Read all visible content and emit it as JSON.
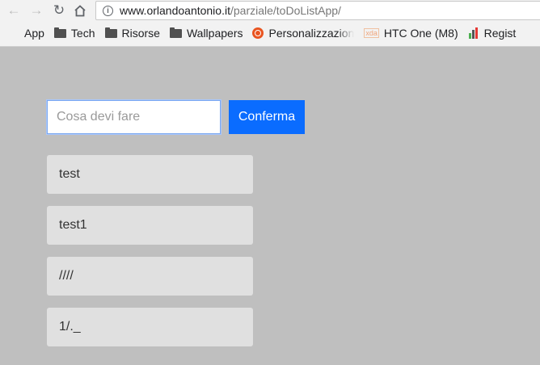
{
  "browser": {
    "url_host": "www.orlandoantonio.it",
    "url_path": "/parziale/toDoListApp/",
    "bookmarks": [
      {
        "label": "App",
        "icon": "apps-grid-icon"
      },
      {
        "label": "Tech",
        "icon": "folder-icon"
      },
      {
        "label": "Risorse",
        "icon": "folder-icon"
      },
      {
        "label": "Wallpapers",
        "icon": "folder-icon"
      },
      {
        "label": "Personalizzazion",
        "icon": "ubuntu-icon"
      },
      {
        "label": "HTC One (M8)",
        "icon": "xda-icon"
      },
      {
        "label": "Regist",
        "icon": "register-icon"
      }
    ]
  },
  "app": {
    "input_placeholder": "Cosa devi fare",
    "input_value": "",
    "confirm_label": "Conferma",
    "tasks": [
      "test",
      "test1",
      "////",
      "1/._"
    ]
  },
  "colors": {
    "page_background": "#bfbfbf",
    "button_blue": "#0a6cff",
    "task_background": "#e0e0e0"
  }
}
